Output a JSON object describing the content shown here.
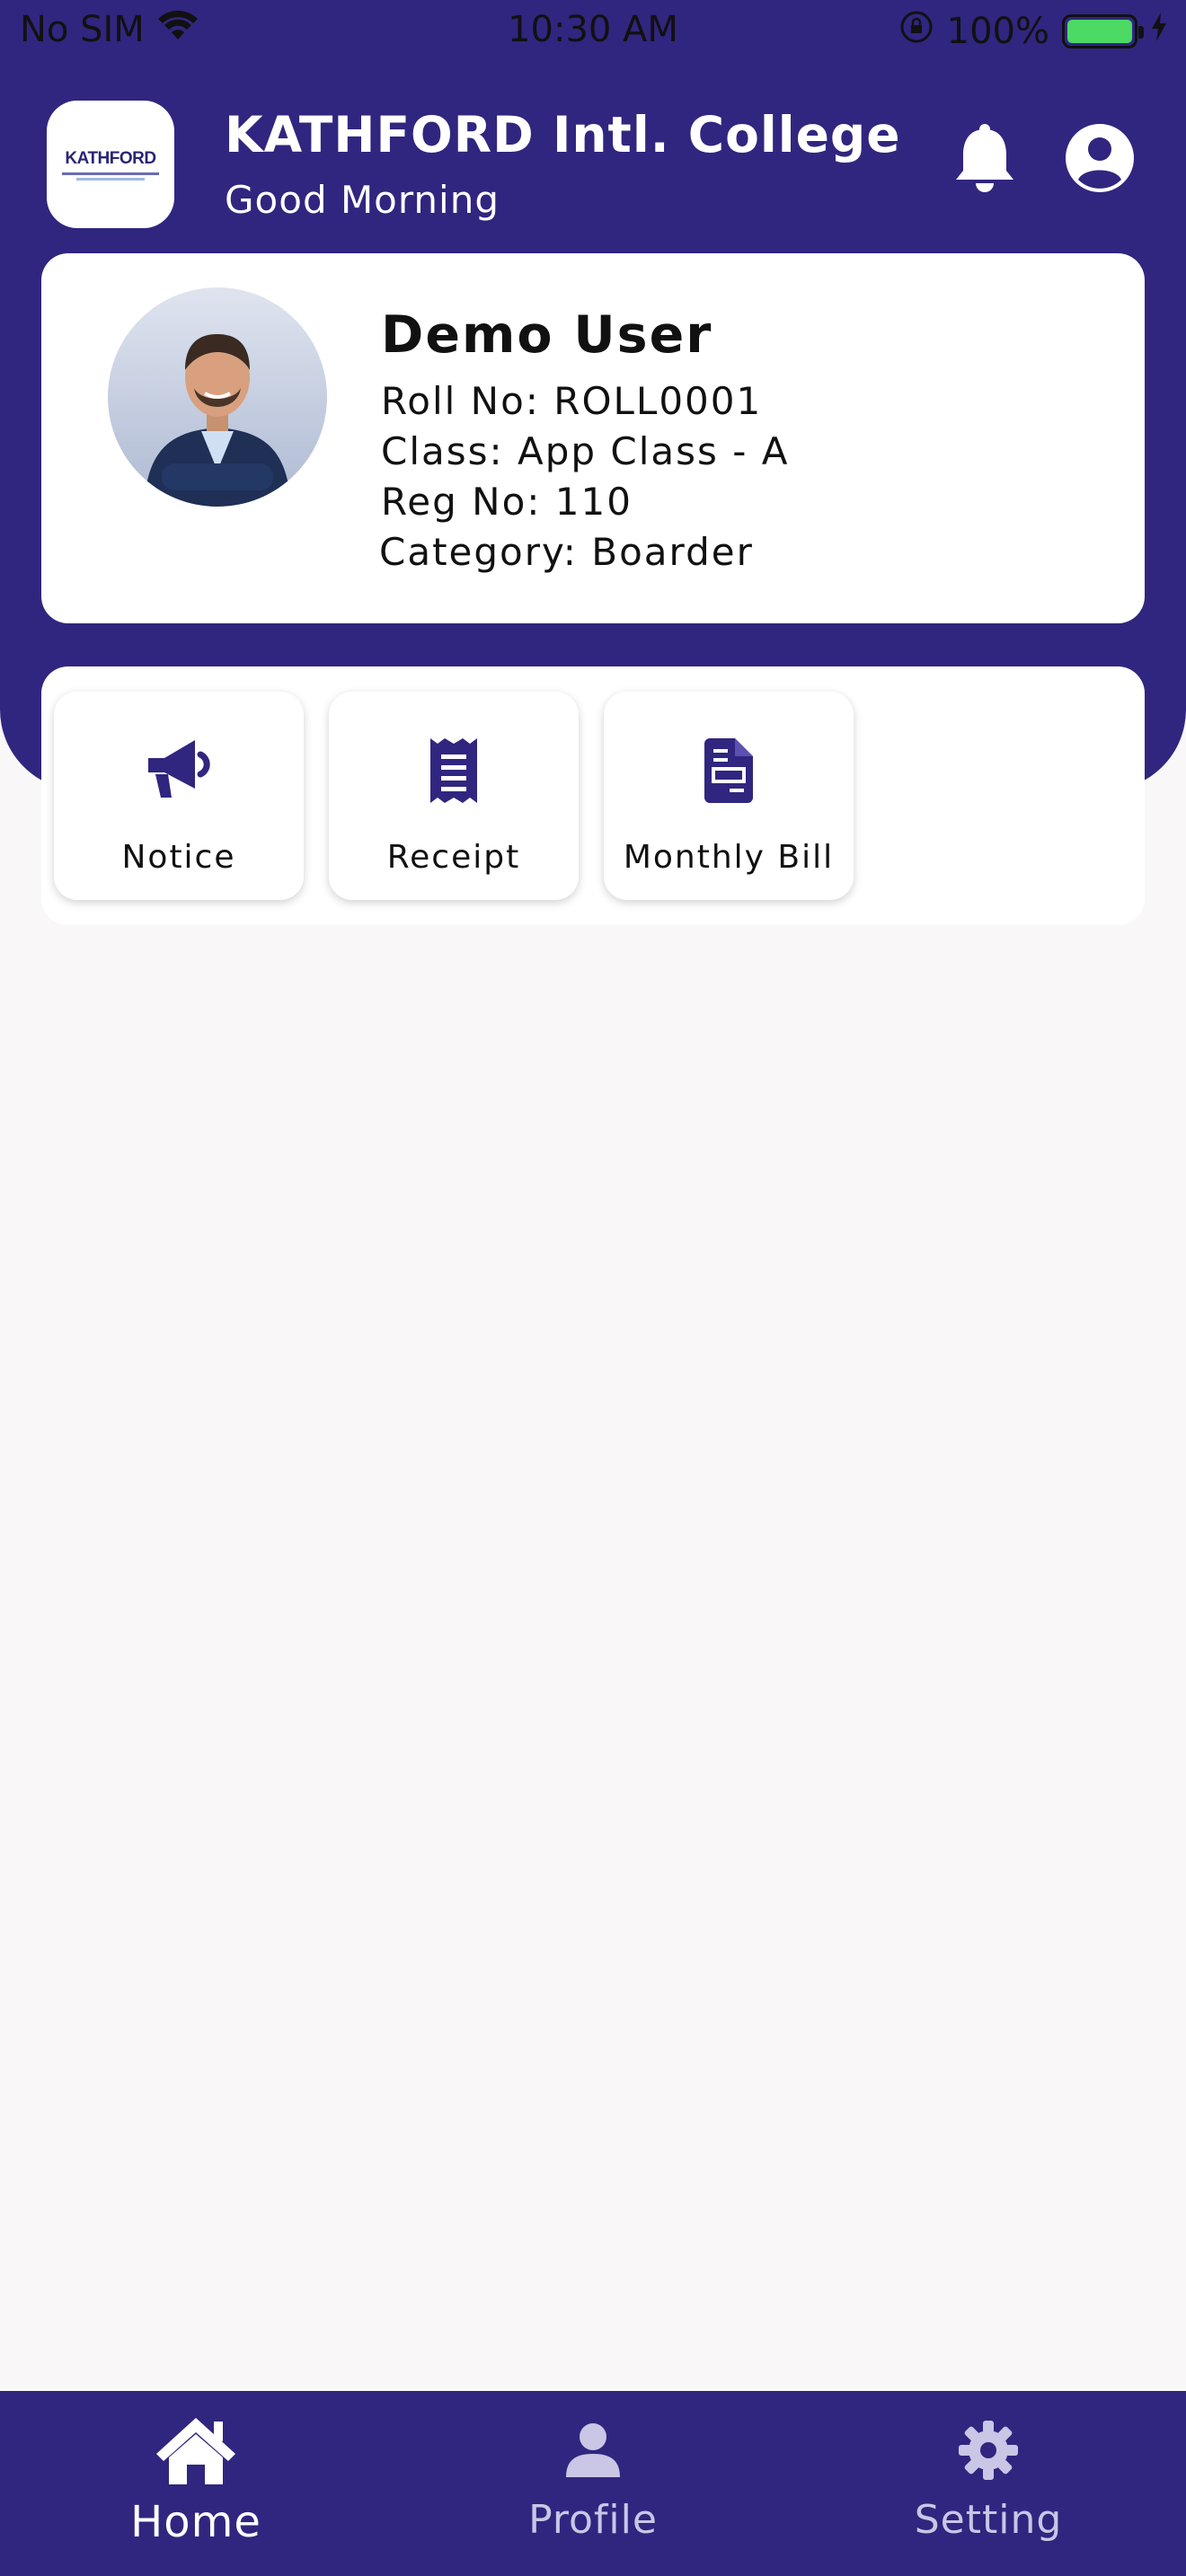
{
  "status_bar": {
    "carrier": "No SIM",
    "time": "10:30 AM",
    "battery_percent": "100%",
    "battery_level": 1.0
  },
  "header": {
    "logo_text": "KATHFORD",
    "title": "KATHFORD Intl. College ...",
    "greeting": "Good Morning",
    "notification_icon": "bell-icon",
    "account_icon": "account-circle-icon"
  },
  "profile": {
    "name": "Demo User",
    "roll": "Roll No: ROLL0001",
    "class": "Class: App Class - A",
    "reg": "Reg No: 110",
    "category": "Category: Boarder"
  },
  "actions": [
    {
      "label": "Notice",
      "icon": "megaphone-icon"
    },
    {
      "label": "Receipt",
      "icon": "receipt-icon"
    },
    {
      "label": "Monthly Bill",
      "icon": "bill-document-icon"
    }
  ],
  "bottom_nav": [
    {
      "label": "Home",
      "icon": "home-icon",
      "active": true
    },
    {
      "label": "Profile",
      "icon": "person-icon",
      "active": false
    },
    {
      "label": "Setting",
      "icon": "gear-icon",
      "active": false
    }
  ],
  "colors": {
    "brand": "#30267f",
    "background": "#f9f7f8",
    "battery": "#4cd964"
  }
}
